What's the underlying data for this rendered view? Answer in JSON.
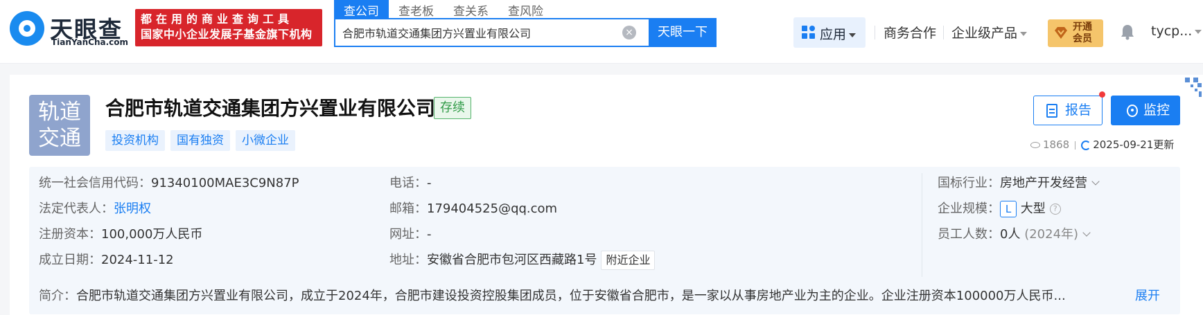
{
  "header": {
    "logo_cn": "天眼查",
    "logo_en": "TianYanCha.com",
    "slogan_line1": "都在用的商业查询工具",
    "slogan_line2": "国家中小企业发展子基金旗下机构",
    "search_tabs": [
      "查公司",
      "查老板",
      "查关系",
      "查风险"
    ],
    "search_value": "合肥市轨道交通集团方兴置业有限公司",
    "search_button": "天眼一下",
    "apps_label": "应用",
    "nav_business": "商务合作",
    "nav_enterprise": "企业级产品",
    "vip_line1": "开通",
    "vip_line2": "会员",
    "user": "tycp..."
  },
  "company": {
    "logo_line1": "轨道",
    "logo_line2": "交通",
    "name": "合肥市轨道交通集团方兴置业有限公司",
    "status": "存续",
    "tags": [
      "投资机构",
      "国有独资",
      "小微企业"
    ],
    "report_label": "报告",
    "monitor_label": "监控",
    "views": "1868",
    "updated": "2025-09-21更新"
  },
  "info": {
    "credit_code_label": "统一社会信用代码：",
    "credit_code": "91340100MAE3C9N87P",
    "legal_rep_label": "法定代表人：",
    "legal_rep": "张明权",
    "capital_label": "注册资本：",
    "capital": "100,000万人民币",
    "founded_label": "成立日期：",
    "founded": "2024-11-12",
    "phone_label": "电话：",
    "phone": "-",
    "email_label": "邮箱：",
    "email": "179404525@qq.com",
    "website_label": "网址：",
    "website": "-",
    "address_label": "地址：",
    "address": "安徽省合肥市包河区西藏路1号",
    "nearby_label": "附近企业",
    "industry_label": "国标行业：",
    "industry": "房地产开发经营",
    "scale_label": "企业规模：",
    "scale_badge": "L",
    "scale": "大型",
    "staff_label": "员工人数：",
    "staff": "0人",
    "staff_year": "(2024年)",
    "intro_label": "简介：",
    "intro": "合肥市轨道交通集团方兴置业有限公司，成立于2024年，合肥市建设投资控股集团成员，位于安徽省合肥市，是一家以从事房地产业为主的企业。企业注册资本100000万人民币...",
    "expand_label": "展开"
  }
}
